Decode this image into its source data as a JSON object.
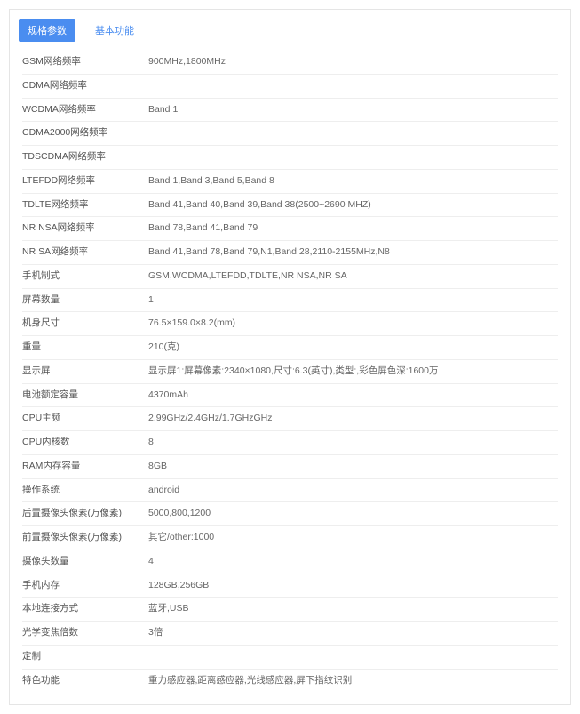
{
  "tabs": {
    "active": "规格参数",
    "other": "基本功能"
  },
  "specs": [
    {
      "label": "GSM网络频率",
      "value": "900MHz,1800MHz"
    },
    {
      "label": "CDMA网络频率",
      "value": ""
    },
    {
      "label": "WCDMA网络频率",
      "value": "Band 1"
    },
    {
      "label": "CDMA2000网络频率",
      "value": ""
    },
    {
      "label": "TDSCDMA网络频率",
      "value": ""
    },
    {
      "label": "LTEFDD网络频率",
      "value": "Band 1,Band 3,Band 5,Band 8"
    },
    {
      "label": "TDLTE网络频率",
      "value": "Band 41,Band 40,Band 39,Band 38(2500~2690 MHZ)"
    },
    {
      "label": "NR NSA网络频率",
      "value": "Band 78,Band 41,Band 79"
    },
    {
      "label": "NR SA网络频率",
      "value": "Band 41,Band 78,Band 79,N1,Band 28,2110-2155MHz,N8"
    },
    {
      "label": "手机制式",
      "value": "GSM,WCDMA,LTEFDD,TDLTE,NR NSA,NR SA"
    },
    {
      "label": "屏幕数量",
      "value": "1"
    },
    {
      "label": "机身尺寸",
      "value": "76.5×159.0×8.2(mm)"
    },
    {
      "label": "重量",
      "value": "210(克)"
    },
    {
      "label": "显示屏",
      "value": "显示屏1:屏幕像素:2340×1080,尺寸:6.3(英寸),类型:,彩色屏色深:1600万"
    },
    {
      "label": "电池额定容量",
      "value": "4370mAh"
    },
    {
      "label": "CPU主频",
      "value": "2.99GHz/2.4GHz/1.7GHzGHz"
    },
    {
      "label": "CPU内核数",
      "value": "8"
    },
    {
      "label": "RAM内存容量",
      "value": "8GB"
    },
    {
      "label": "操作系统",
      "value": "android"
    },
    {
      "label": "后置摄像头像素(万像素)",
      "value": "5000,800,1200"
    },
    {
      "label": "前置摄像头像素(万像素)",
      "value": "其它/other:1000"
    },
    {
      "label": "摄像头数量",
      "value": "4"
    },
    {
      "label": "手机内存",
      "value": "128GB,256GB"
    },
    {
      "label": "本地连接方式",
      "value": "蓝牙,USB"
    },
    {
      "label": "光学变焦倍数",
      "value": "3倍"
    },
    {
      "label": "定制",
      "value": ""
    },
    {
      "label": "特色功能",
      "value": "重力感应器,距离感应器,光线感应器,屏下指纹识别"
    }
  ]
}
